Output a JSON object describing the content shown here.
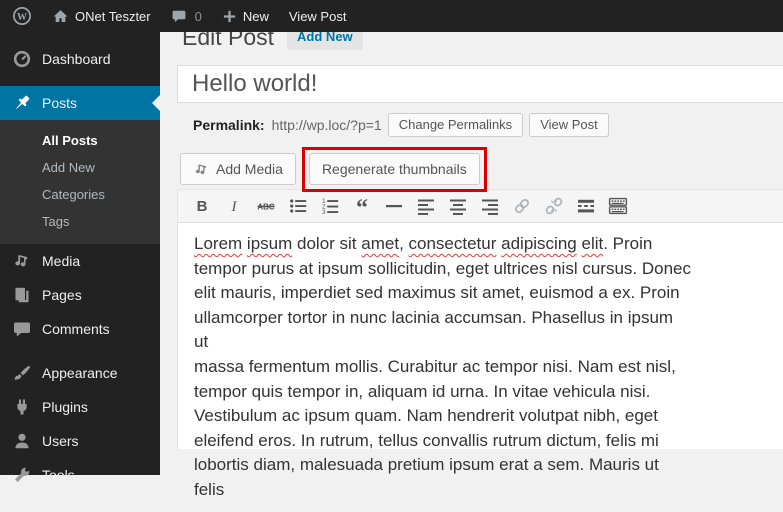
{
  "colors": {
    "accent": "#0074a2",
    "annotation_red": "#dd0000",
    "admin_dark": "#222222",
    "page_bg": "#f1f1f1"
  },
  "admin_bar": {
    "logo_icon": "wordpress-logo-icon",
    "home_icon": "home-icon",
    "site_name": "ONet Teszter",
    "comments_icon": "comment-bubble-icon",
    "comments_count": "0",
    "new_icon": "plus-icon",
    "new_label": "New",
    "view_post_label": "View Post"
  },
  "sidebar": {
    "items": [
      {
        "id": "dashboard",
        "label": "Dashboard",
        "icon": "dashboard-icon"
      },
      {
        "id": "posts",
        "label": "Posts",
        "icon": "pin-icon",
        "active": true,
        "separator_before": true,
        "submenu": [
          {
            "label": "All Posts",
            "current": true
          },
          {
            "label": "Add New"
          },
          {
            "label": "Categories"
          },
          {
            "label": "Tags"
          }
        ]
      },
      {
        "id": "media",
        "label": "Media",
        "icon": "media-icon"
      },
      {
        "id": "pages",
        "label": "Pages",
        "icon": "pages-icon"
      },
      {
        "id": "comments",
        "label": "Comments",
        "icon": "comments-icon"
      },
      {
        "id": "appearance",
        "label": "Appearance",
        "icon": "appearance-icon",
        "separator_before": true
      },
      {
        "id": "plugins",
        "label": "Plugins",
        "icon": "plugins-icon"
      },
      {
        "id": "users",
        "label": "Users",
        "icon": "users-icon"
      },
      {
        "id": "tools",
        "label": "Tools",
        "icon": "tools-icon"
      }
    ]
  },
  "main": {
    "page_title": "Edit Post",
    "add_new_button": "Add New",
    "title_input_value": "Hello world!",
    "permalink": {
      "label": "Permalink:",
      "url": "http://wp.loc/?p=1",
      "change_button": "Change Permalinks",
      "view_button": "View Post"
    },
    "media_row": {
      "add_media_icon": "media-icon",
      "add_media_button": "Add Media",
      "regenerate_button": "Regenerate thumbnails"
    },
    "editor": {
      "toolbar": [
        {
          "name": "bold"
        },
        {
          "name": "italic"
        },
        {
          "name": "strikethrough"
        },
        {
          "name": "bullet-list"
        },
        {
          "name": "numbered-list"
        },
        {
          "name": "blockquote"
        },
        {
          "name": "horizontal-rule"
        },
        {
          "name": "align-left"
        },
        {
          "name": "align-center"
        },
        {
          "name": "align-right"
        },
        {
          "name": "link",
          "disabled": true
        },
        {
          "name": "unlink",
          "disabled": true
        },
        {
          "name": "more-tag"
        },
        {
          "name": "toolbar-toggle"
        }
      ],
      "content": {
        "line1_parts": [
          {
            "t": "Lorem",
            "sp": true
          },
          {
            "t": " "
          },
          {
            "t": "ipsum",
            "sp": true
          },
          {
            "t": " dolor sit "
          },
          {
            "t": "amet",
            "sp": true
          },
          {
            "t": ", "
          },
          {
            "t": "consectetur",
            "sp": true
          },
          {
            "t": " "
          },
          {
            "t": "adipiscing",
            "sp": true
          },
          {
            "t": " "
          },
          {
            "t": "elit",
            "sp": true
          },
          {
            "t": ". Proin"
          }
        ],
        "lines": [
          "tempor purus at ipsum sollicitudin, eget ultrices nisl cursus. Donec",
          "elit mauris, imperdiet sed maximus sit amet, euismod a ex. Proin",
          "ullamcorper tortor in nunc lacinia accumsan. Phasellus in ipsum ut",
          "massa fermentum mollis. Curabitur ac tempor nisi. Nam est nisl,",
          "tempor quis tempor in, aliquam id urna. In vitae vehicula nisi.",
          "Vestibulum ac ipsum quam. Nam hendrerit volutpat nibh, eget",
          "eleifend eros. In rutrum, tellus convallis rutrum dictum, felis mi",
          "lobortis diam, malesuada pretium ipsum erat a sem. Mauris ut felis"
        ]
      }
    }
  }
}
